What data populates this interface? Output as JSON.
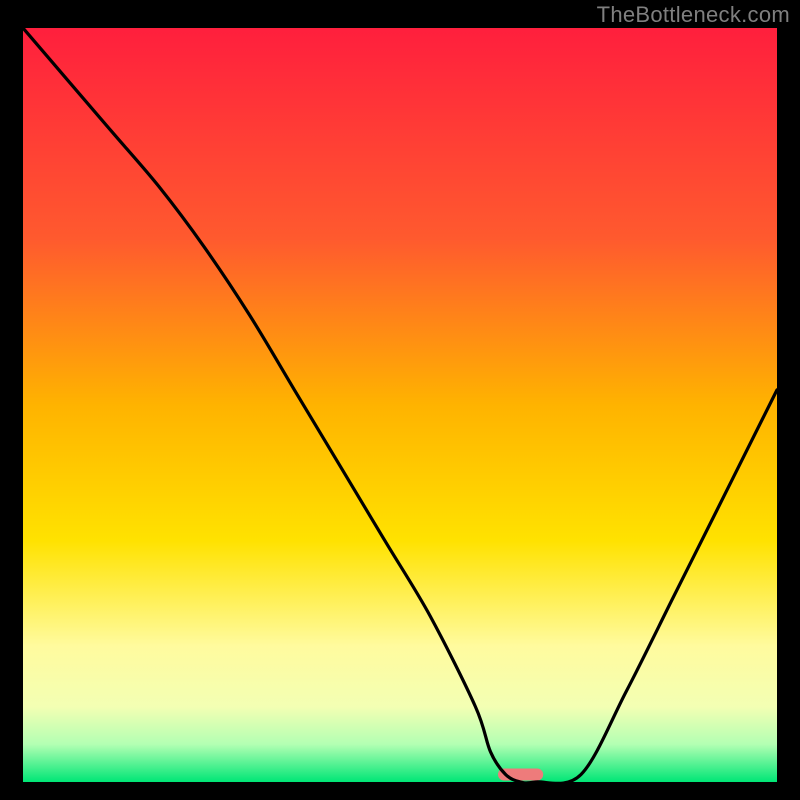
{
  "watermark": "TheBottleneck.com",
  "chart_data": {
    "type": "line",
    "title": "",
    "xlabel": "",
    "ylabel": "",
    "xlim": [
      0,
      100
    ],
    "ylim": [
      0,
      100
    ],
    "gradient_stops": [
      {
        "offset": 0,
        "color": "#ff1f3d"
      },
      {
        "offset": 28,
        "color": "#ff5a2e"
      },
      {
        "offset": 50,
        "color": "#ffb300"
      },
      {
        "offset": 68,
        "color": "#ffe200"
      },
      {
        "offset": 82,
        "color": "#fffb9e"
      },
      {
        "offset": 90,
        "color": "#f3ffb3"
      },
      {
        "offset": 95,
        "color": "#b3ffb3"
      },
      {
        "offset": 100,
        "color": "#00e676"
      }
    ],
    "series": [
      {
        "name": "bottleneck-curve",
        "x": [
          0,
          6,
          12,
          18,
          24,
          30,
          36,
          42,
          48,
          54,
          60,
          62,
          64,
          66,
          68,
          74,
          80,
          86,
          92,
          98,
          100
        ],
        "y": [
          100,
          93,
          86,
          79,
          71,
          62,
          52,
          42,
          32,
          22,
          10,
          4,
          1,
          0,
          0,
          1,
          12,
          24,
          36,
          48,
          52
        ]
      }
    ],
    "marker": {
      "name": "optimal-range-marker",
      "x_start": 63,
      "x_end": 69,
      "y": 1,
      "color": "#ee7b7b"
    }
  }
}
